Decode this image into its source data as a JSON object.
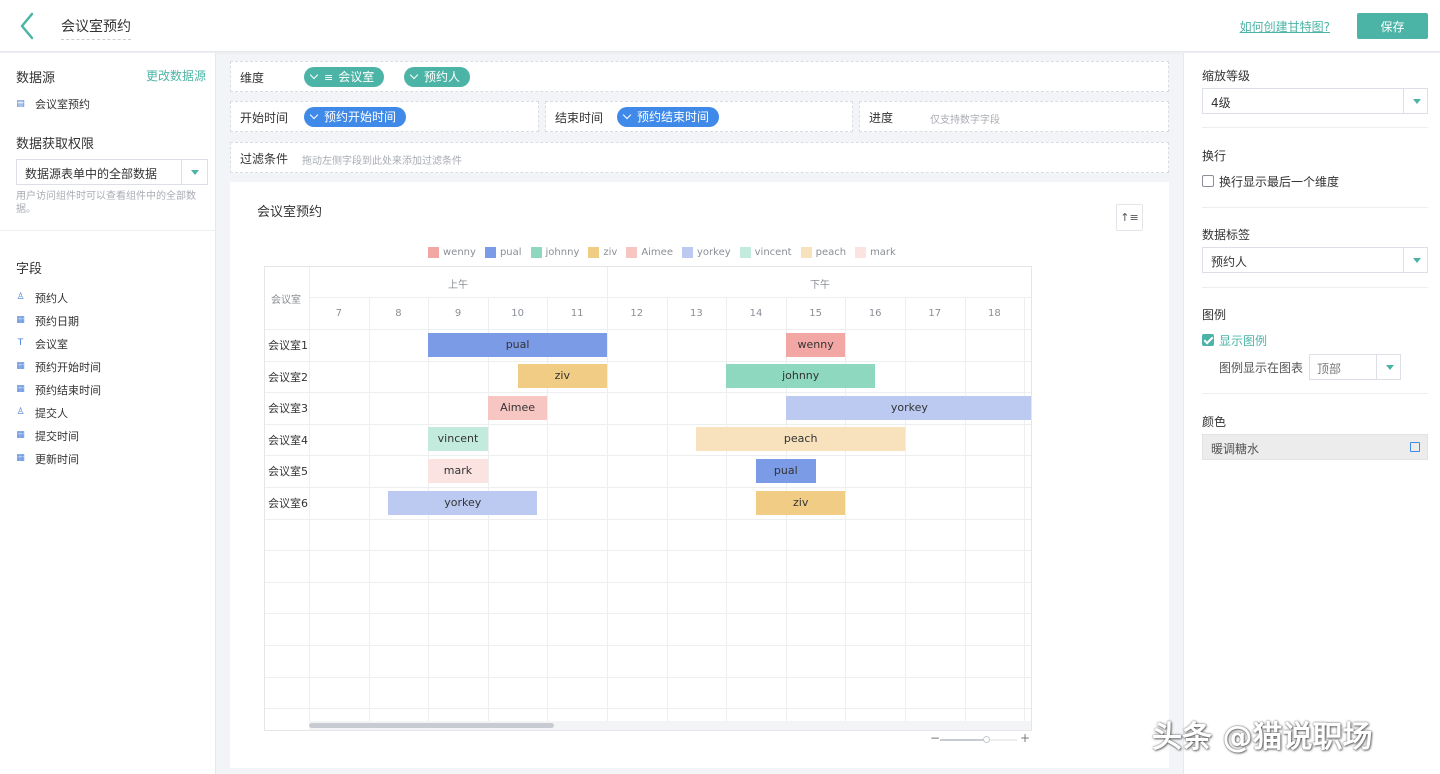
{
  "header": {
    "title": "会议室预约",
    "help_link": "如何创建甘特图?",
    "save_label": "保存"
  },
  "left": {
    "datasource_title": "数据源",
    "change_datasource": "更改数据源",
    "datasource_name": "会议室预约",
    "permission_title": "数据获取权限",
    "permission_value": "数据源表单中的全部数据",
    "permission_hint": "用户访问组件时可以查看组件中的全部数据。",
    "fields_title": "字段",
    "fields": [
      {
        "label": "预约人",
        "icon": "person-icon"
      },
      {
        "label": "预约日期",
        "icon": "calendar-icon"
      },
      {
        "label": "会议室",
        "icon": "text-icon"
      },
      {
        "label": "预约开始时间",
        "icon": "calendar-icon"
      },
      {
        "label": "预约结束时间",
        "icon": "calendar-icon"
      },
      {
        "label": "提交人",
        "icon": "person-icon"
      },
      {
        "label": "提交时间",
        "icon": "calendar-icon"
      },
      {
        "label": "更新时间",
        "icon": "calendar-icon"
      }
    ]
  },
  "config": {
    "dimension_label": "维度",
    "dimension_pills": [
      "会议室",
      "预约人"
    ],
    "start_label": "开始时间",
    "start_pill": "预约开始时间",
    "end_label": "结束时间",
    "end_pill": "预约结束时间",
    "progress_label": "进度",
    "progress_hint": "仅支持数字字段",
    "filter_label": "过滤条件",
    "filter_hint": "拖动左侧字段到此处来添加过滤条件"
  },
  "chart": {
    "title": "会议室预约",
    "room_header": "会议室",
    "periods": [
      "上午",
      "下午"
    ],
    "hours": [
      "7",
      "8",
      "9",
      "10",
      "11",
      "12",
      "13",
      "14",
      "15",
      "16",
      "17",
      "18"
    ],
    "rooms": [
      "会议室1",
      "会议室2",
      "会议室3",
      "会议室4",
      "会议室5",
      "会议室6"
    ]
  },
  "chart_data": {
    "type": "gantt",
    "title": "会议室预约",
    "x_unit": "hour",
    "x_range": [
      6.5,
      19.4
    ],
    "legend": [
      {
        "name": "wenny",
        "color": "#f2a7a5"
      },
      {
        "name": "pual",
        "color": "#7c9be6"
      },
      {
        "name": "johnny",
        "color": "#8ed8c0"
      },
      {
        "name": "ziv",
        "color": "#f1cc85"
      },
      {
        "name": "Aimee",
        "color": "#f7c6c3"
      },
      {
        "name": "yorkey",
        "color": "#bccaf2"
      },
      {
        "name": "vincent",
        "color": "#c2ebdd"
      },
      {
        "name": "peach",
        "color": "#f8e2bd"
      },
      {
        "name": "mark",
        "color": "#fbe3e2"
      }
    ],
    "tasks": [
      {
        "room": "会议室1",
        "person": "pual",
        "start": 8.5,
        "end": 11.5
      },
      {
        "room": "会议室1",
        "person": "wenny",
        "start": 14.5,
        "end": 15.5
      },
      {
        "room": "会议室2",
        "person": "ziv",
        "start": 10.0,
        "end": 11.5
      },
      {
        "room": "会议室2",
        "person": "johnny",
        "start": 13.5,
        "end": 16.0
      },
      {
        "room": "会议室3",
        "person": "Aimee",
        "start": 9.5,
        "end": 10.5
      },
      {
        "room": "会议室3",
        "person": "yorkey",
        "start": 14.5,
        "end": 19.4
      },
      {
        "room": "会议室4",
        "person": "vincent",
        "start": 8.5,
        "end": 9.5
      },
      {
        "room": "会议室4",
        "person": "peach",
        "start": 13.0,
        "end": 16.5
      },
      {
        "room": "会议室5",
        "person": "mark",
        "start": 8.5,
        "end": 9.5
      },
      {
        "room": "会议室5",
        "person": "pual",
        "start": 14.0,
        "end": 15.0
      },
      {
        "room": "会议室6",
        "person": "yorkey",
        "start": 7.83,
        "end": 10.33
      },
      {
        "room": "会议室6",
        "person": "ziv",
        "start": 14.0,
        "end": 15.5
      }
    ]
  },
  "right": {
    "zoom_title": "缩放等级",
    "zoom_value": "4级",
    "wrap_title": "换行",
    "wrap_option": "换行显示最后一个维度",
    "wrap_checked": false,
    "label_title": "数据标签",
    "label_value": "预约人",
    "legend_title": "图例",
    "legend_show": "显示图例",
    "legend_show_checked": true,
    "legend_pos_label": "图例显示在图表",
    "legend_pos_value": "顶部",
    "color_title": "颜色",
    "color_value": "暖调糖水"
  },
  "watermark": "头条 @猫说职场"
}
